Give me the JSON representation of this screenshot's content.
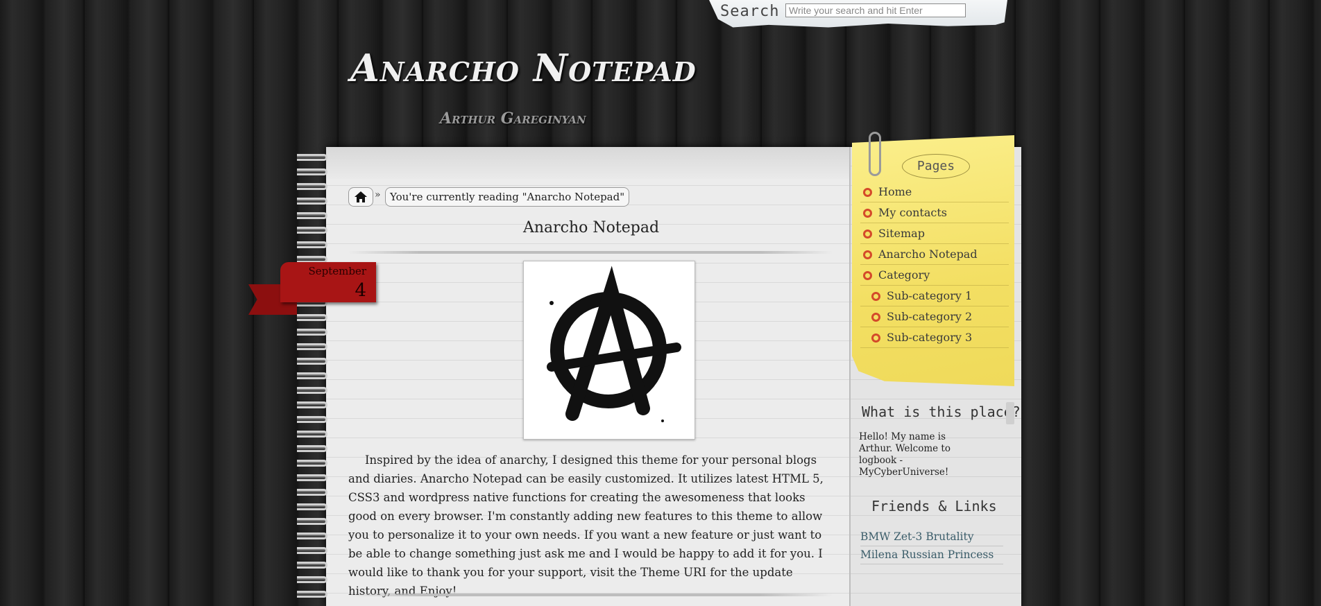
{
  "search": {
    "label": "Search",
    "placeholder": "Write your search and hit Enter"
  },
  "header": {
    "title": "Anarcho Notepad",
    "tagline": "Arthur Gareginyan"
  },
  "breadcrumb": {
    "separator": "»",
    "current": "You're currently reading \"Anarcho Notepad\""
  },
  "post": {
    "title": "Anarcho Notepad",
    "date": {
      "month": "September",
      "day": "4"
    },
    "body": "Inspired by the idea of anarchy, I designed this theme for your personal blogs and diaries. Anarcho Notepad can be easily customized. It utilizes latest HTML 5, CSS3 and wordpress native functions for creating the awesomeness that looks good on every browser. I'm constantly adding new features to this theme to allow you to personalize it to your own needs. If you want a new feature or just want to be able to change something just ask me and I would be happy to add it for you. I would like to thank you for your support, visit the Theme URI for the update history, and Enjoy!"
  },
  "sidebar": {
    "pages_title": "Pages",
    "pages": [
      {
        "label": "Home",
        "sub": false
      },
      {
        "label": "My contacts",
        "sub": false
      },
      {
        "label": "Sitemap",
        "sub": false
      },
      {
        "label": "Anarcho Notepad",
        "sub": false
      },
      {
        "label": "Category",
        "sub": false
      },
      {
        "label": "Sub-category 1",
        "sub": true
      },
      {
        "label": "Sub-category 2",
        "sub": true
      },
      {
        "label": "Sub-category 3",
        "sub": true
      }
    ],
    "about_title": "What is this place?",
    "about_text": "Hello! My name is Arthur. Welcome to logbook - MyCyberUniverse!",
    "links_title": "Friends & Links",
    "links": [
      "BMW Zet-3 Brutality",
      "Milena Russian Princess"
    ]
  },
  "colors": {
    "ribbon": "#a81515",
    "sticky_note": "#f3df63",
    "bullet": "#d44a2a",
    "link": "#3b5d6a"
  },
  "icons": {
    "home": "home-icon",
    "post_image": "anarchy-symbol"
  }
}
